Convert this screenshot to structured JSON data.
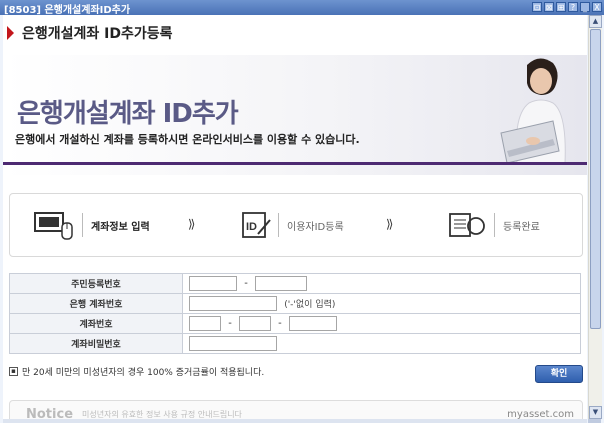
{
  "window": {
    "title": "[8503] 은행개설계좌ID추가",
    "buttons": [
      "⊡",
      "⊠",
      "⊞",
      "?",
      "_",
      "X"
    ]
  },
  "page_header": {
    "title": "은행개설계좌 ID추가등록"
  },
  "banner": {
    "headline": "은행개설계좌 ID추가",
    "subtitle": "은행에서 개설하신 계좌를 등록하시면 온라인서비스를 이용할 수 있습니다."
  },
  "steps": [
    {
      "label": "계좌정보 입력",
      "active": true,
      "icon": "computer-icon"
    },
    {
      "label": "이용자ID등록",
      "active": false,
      "icon": "id-card-icon"
    },
    {
      "label": "등록완료",
      "active": false,
      "icon": "document-complete-icon"
    }
  ],
  "form": {
    "rows": [
      {
        "label": "주민등록번호"
      },
      {
        "label": "은행 계좌번호",
        "hint": "('-'없이 입력)"
      },
      {
        "label": "계좌번호"
      },
      {
        "label": "계좌비밀번호"
      }
    ],
    "dash": "-"
  },
  "note": {
    "text": "만 20세 미만의 미성년자의 경우 100% 증거금률이 적용됩니다.",
    "button": "확인"
  },
  "notice": {
    "title": "Notice",
    "text": "미성년자의 유효한 정보 사용 규정 안내드립니다",
    "brand": "myasset.com"
  },
  "colors": {
    "titlebar": "#4a72b6",
    "accent_red": "#c3161c",
    "banner_line": "#4d2a72",
    "button": "#2f5fae"
  }
}
